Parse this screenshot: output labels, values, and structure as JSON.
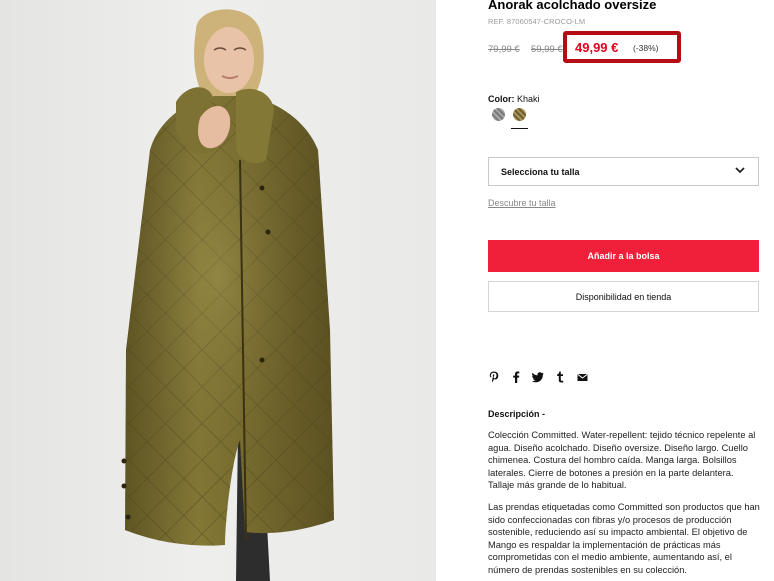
{
  "product": {
    "title": "Anorak acolchado oversize",
    "ref": "REF. 87060547-CROCO-LM"
  },
  "pricing": {
    "original_price": "79,99 €",
    "previous_price": "59,99 €",
    "current_price": "49,99 €",
    "discount": "(-38%)",
    "highlight_color": "#b50d14",
    "sale_color": "#e2001a"
  },
  "color": {
    "label": "Color:",
    "value": "Khaki",
    "swatches": [
      "grey-pattern",
      "khaki-pattern"
    ]
  },
  "size": {
    "select_label": "Selecciona tu talla",
    "guide_link": "Descubre tu talla"
  },
  "actions": {
    "add_to_bag": "Añadir a la bolsa",
    "store_availability": "Disponibilidad en tienda",
    "add_button_color": "#f0203a"
  },
  "share_icons": [
    "pinterest-icon",
    "facebook-icon",
    "twitter-icon",
    "tumblr-icon",
    "email-icon"
  ],
  "description": {
    "title": "Descripción -",
    "paragraph1": "Colección Committed. Water-repellent: tejido técnico repelente al agua. Diseño acolchado. Diseño oversize. Diseño largo. Cuello chimenea. Costura del hombro caída. Manga larga. Bolsillos laterales. Cierre de botones a presión en la parte delantera. Tallaje más grande de lo habitual.",
    "paragraph2": "Las prendas etiquetadas como Committed son productos que han sido confeccionadas con fibras y/o procesos de producción sostenible, reduciendo así su impacto ambiental. El objetivo de Mango es respaldar la implementación de prácticas más comprometidas con el medio ambiente, aumentando así, el número de prendas sostenibles en su colección."
  }
}
